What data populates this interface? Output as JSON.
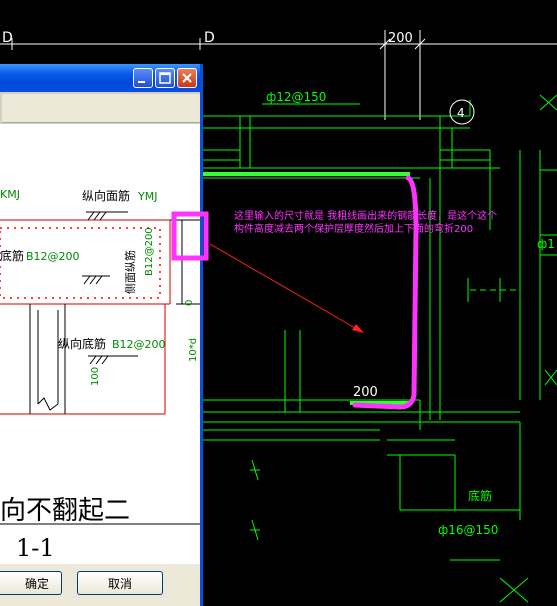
{
  "cad": {
    "dim_top_left": "D",
    "dim_top_mid": "D",
    "dim_top_right": "200",
    "rebar_top": "ф12@150",
    "rebar_bottom": "ф16@150",
    "rebar_right": "ф1",
    "circle_label": "4",
    "dim_200": "200",
    "label_bottom_right": "底筋",
    "annotation_line1": "这里输入的尺寸就是 我粗线画出来的钢筋长度，是这个这个",
    "annotation_line2": "构件高度减去两个保护层厚度然后加上下面的弯折200",
    "colors": {
      "background": "#000000",
      "cad_green": "#00ff00",
      "annotation_magenta": "#ff33ff",
      "pointer_red": "#ff2020"
    }
  },
  "dialog": {
    "drawing": {
      "label_top_left": "KMJ",
      "label_face_rebar": "纵向面筋",
      "label_face_rebar_code": "YMJ",
      "label_bottom_rebar_short": "底筋",
      "label_bottom_rebar_spec": "B12@200",
      "label_side_rebar": "侧面纵筋",
      "label_side_rebar_spec": "B12@200",
      "label_long_bottom": "纵向底筋",
      "label_long_bottom_spec": "B12@200",
      "dim_100": "100",
      "dim_10d": "10*d",
      "input_value": "0",
      "big_title": "向不翻起二",
      "section_label": "1-1"
    },
    "buttons": {
      "ok": "确定",
      "cancel": "取消"
    }
  }
}
